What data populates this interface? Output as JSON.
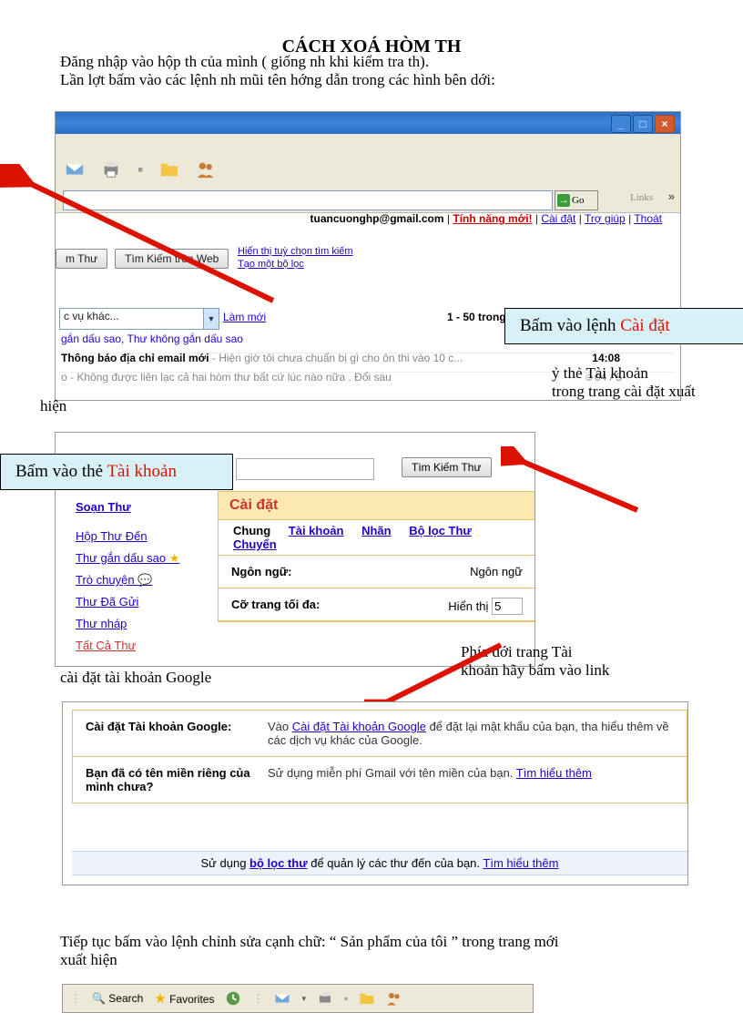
{
  "title": "CÁCH XOÁ HÒM TH",
  "intro_line1": "Đăng nhập vào hộp th   của mình ( giống nh   khi kiểm tra th).",
  "intro_line2": "Lần lợt   bấm vào các lệnh nh   mũi tên hớng   dẫn trong các hình bên dới:",
  "win": {
    "minimize_tip": "Minimize",
    "go": "Go",
    "links": "Links"
  },
  "gm": {
    "email": "tuancuonghp@gmail.com",
    "new_features": "Tính năng mới!",
    "settings": "Cài đặt",
    "help": "Trợ giúp",
    "signout": "Thoát",
    "btn_mail": "m Thư",
    "btn_web": "Tìm Kiếm trên Web",
    "search_opts": "Hiển thị tuỳ chọn tìm kiếm",
    "create_filter": "Tạo một bộ lọc",
    "more_combo": "c vụ khác...",
    "refresh": "Làm mới",
    "count": "1 - 50 trong s",
    "row1": "gắn dấu sao, Thư không gắn dấu sao",
    "row2a": "Thông báo địa chỉ email mới",
    "row2b": " - Hiện giờ tôi chưa chuẩn bị gì cho ôn thi vào 10 c...",
    "row2time": "14:08",
    "row3a": "o - Không được liên lạc cả hai hòm thư bất cứ lúc nào nữa . Đổi sau",
    "row3date": "☺04 / 5"
  },
  "call1_a": "Bấm vào lệnh ",
  "call1_b": "Cài đặt",
  "mid_a": "ỷ thẻ Tài khoản",
  "mid_b": "trong trang cài đặt xuất",
  "mid_c": "hiện",
  "s2": {
    "search_btn": "Tìm Kiếm Thư",
    "compose": "Soạn Thư",
    "inbox": "Hộp Thư Đến",
    "starred": "Thư gắn dấu sao",
    "chat": "Trò chuyện",
    "sent": "Thư Đã Gửi",
    "draft": "Thư nháp",
    "all": "Tất Cả Thư",
    "settings": "Cài đặt",
    "tab_general": "Chung",
    "tab_accounts": "Tài khoản",
    "tab_labels": "Nhãn",
    "tab_filters": "Bộ lọc Thư",
    "tab_fwd": "Chuyển",
    "lang_label": "Ngôn ngữ:",
    "lang_right": "Ngôn ngữ",
    "page_label": "Cỡ trang tối đa:",
    "page_right": "Hiển thị",
    "page_val": "5"
  },
  "call2_a": "Bấm vào thẻ ",
  "call2_b": "Tài khoản",
  "below_a": "Phía dới   trang Tài",
  "below_b": "khoản hãy bấm vào link",
  "below_c": "cài đặt tài khoản Google",
  "s3": {
    "label1": "Cài đặt Tài khoản Google:",
    "val1a": "Vào ",
    "val1link": "Cài đặt Tài khoản Google",
    "val1b": " để đặt lại mật khẩu của bạn, tha hiểu thêm về các dịch vụ khác của Google.",
    "label2": "Bạn đã có tên miền riêng của mình chưa?",
    "val2a": "Sử dụng miễn phí Gmail với tên miền của bạn. ",
    "val2link": "Tìm hiểu thêm",
    "foot_a": "Sử dụng ",
    "foot_link1": "bộ lọc thư",
    "foot_b": " để quản lý các thư đến của bạn.   ",
    "foot_link2": "Tìm hiểu thêm"
  },
  "last_a": "Tiếp tục bấm vào lệnh chỉnh sửa cạnh chữ:  “ Sản phẩm của tôi ” trong trang mới",
  "last_b": "xuất hiện",
  "s4": {
    "search": "Search",
    "favorites": "Favorites"
  }
}
